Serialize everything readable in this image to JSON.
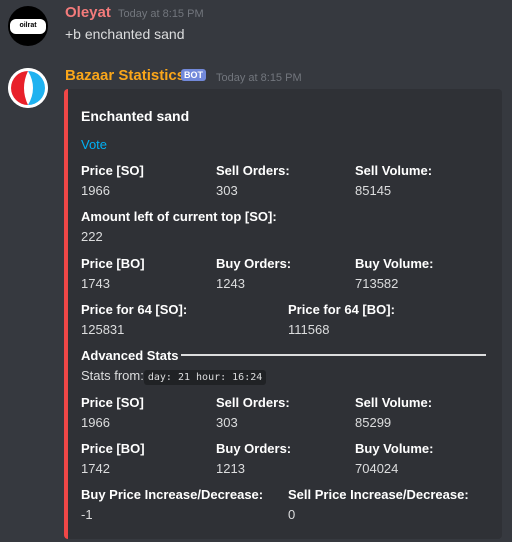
{
  "messages": [
    {
      "author": "Oleyat",
      "timestamp": "Today at 8:15 PM",
      "avatar_text": "oilrat",
      "text": "+b enchanted sand"
    },
    {
      "author": "Bazaar Statistics",
      "badge": "BOT",
      "timestamp": "Today at 8:15 PM"
    }
  ],
  "embed": {
    "title": "Enchanted sand",
    "vote": "Vote",
    "fields": {
      "so_price_label": "Price [SO]",
      "so_price": "1966",
      "sell_orders_label": "Sell Orders:",
      "sell_orders": "303",
      "sell_volume_label": "Sell Volume:",
      "sell_volume": "85145",
      "amount_left_label": "Amount left of current top [SO]:",
      "amount_left": "222",
      "bo_price_label": "Price [BO]",
      "bo_price": "1743",
      "buy_orders_label": "Buy Orders:",
      "buy_orders": "1243",
      "buy_volume_label": "Buy Volume:",
      "buy_volume": "713582",
      "p64_so_label": "Price for 64 [SO]:",
      "p64_so": "125831",
      "p64_bo_label": "Price for 64 [BO]:",
      "p64_bo": "111568"
    },
    "advanced": {
      "heading": "Advanced Stats",
      "stats_from_label": "Stats from:",
      "stats_from_code": "day: 21 hour: 16:24",
      "so_price_label": "Price [SO]",
      "so_price": "1966",
      "sell_orders_label": "Sell Orders:",
      "sell_orders": "303",
      "sell_volume_label": "Sell Volume:",
      "sell_volume": "85299",
      "bo_price_label": "Price [BO]",
      "bo_price": "1742",
      "buy_orders_label": "Buy Orders:",
      "buy_orders": "1213",
      "buy_volume_label": "Buy Volume:",
      "buy_volume": "704024",
      "buy_change_label": "Buy Price Increase/Decrease:",
      "buy_change": "-1",
      "sell_change_label": "Sell Price Increase/Decrease:",
      "sell_change": "0"
    }
  },
  "colors": {
    "user_name": "#f47b7b",
    "bot_name": "#faa61a",
    "embed_border": "#f04747",
    "link": "#00b0f4"
  }
}
